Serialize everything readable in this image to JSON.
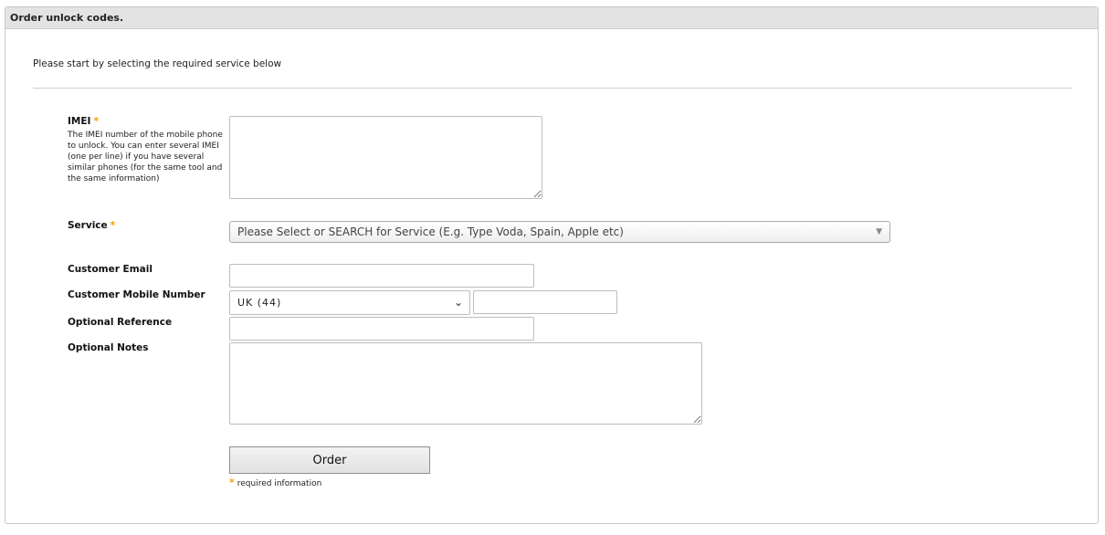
{
  "panel": {
    "title": "Order unlock codes."
  },
  "intro_text": "Please start by selecting the required service below",
  "required_marker": "*",
  "imei": {
    "label": "IMEI",
    "help": "The IMEI number of the mobile phone to unlock. You can enter several IMEI (one per line) if you have several similar phones (for the same tool and the same information)",
    "value": ""
  },
  "service": {
    "label": "Service",
    "placeholder": "Please Select or SEARCH for Service (E.g. Type Voda, Spain, Apple etc)"
  },
  "customer_email": {
    "label": "Customer Email",
    "value": ""
  },
  "customer_mobile": {
    "label": "Customer Mobile Number",
    "country_selected": "UK (44)",
    "number_value": ""
  },
  "optional_reference": {
    "label": "Optional Reference",
    "value": ""
  },
  "optional_notes": {
    "label": "Optional Notes",
    "value": ""
  },
  "order_button": {
    "label": "Order"
  },
  "required_info_text": "required information",
  "icons": {
    "service_dropdown": "triangle-down-icon",
    "country_dropdown": "chevron-down-icon"
  },
  "colors": {
    "required_star": "#f0a000",
    "header_bg": "#e3e3e3"
  }
}
